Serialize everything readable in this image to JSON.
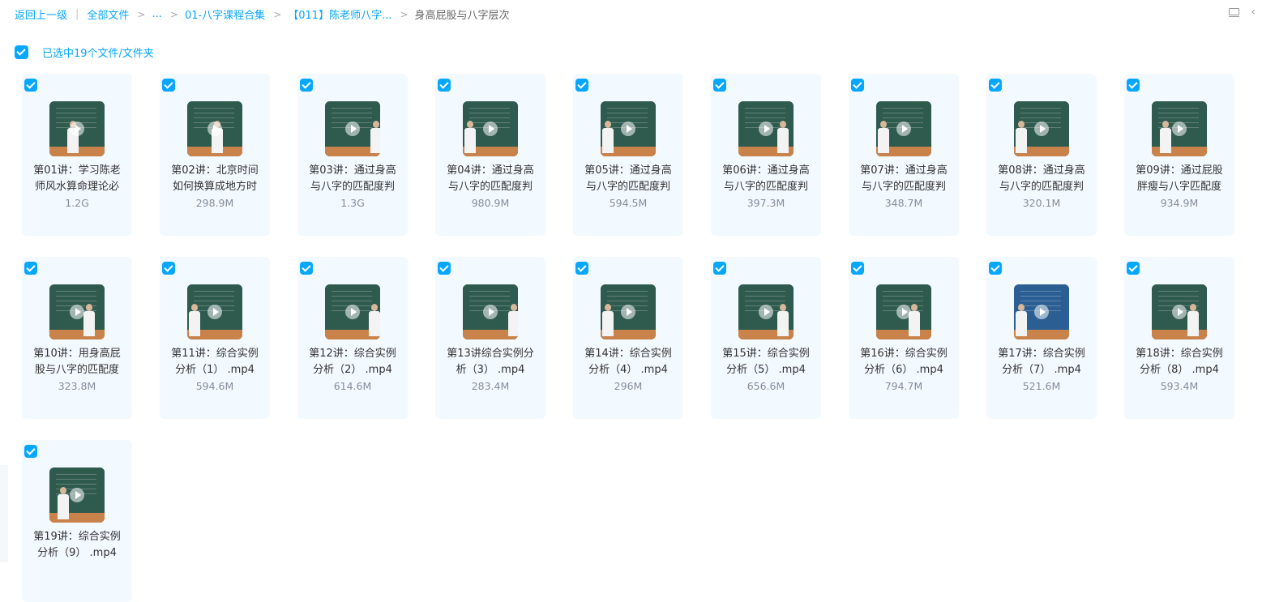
{
  "breadcrumb": {
    "back": "返回上一级",
    "root": "全部文件",
    "ellipsis": "...",
    "folder1": "01-八字课程合集",
    "folder2": "【011】陈老师八字...",
    "current": "身高屁股与八字层次",
    "sep": ">"
  },
  "selection": {
    "text": "已选中19个文件/文件夹"
  },
  "files": [
    {
      "name": "第01讲：学习陈老师风水算命理论必",
      "size": "1.2G"
    },
    {
      "name": "第02讲：北京时间如何换算成地方时",
      "size": "298.9M"
    },
    {
      "name": "第03讲：通过身高与八字的匹配度判",
      "size": "1.3G"
    },
    {
      "name": "第04讲：通过身高与八字的匹配度判",
      "size": "980.9M"
    },
    {
      "name": "第05讲：通过身高与八字的匹配度判",
      "size": "594.5M"
    },
    {
      "name": "第06讲：通过身高与八字的匹配度判",
      "size": "397.3M"
    },
    {
      "name": "第07讲：通过身高与八字的匹配度判",
      "size": "348.7M"
    },
    {
      "name": "第08讲：通过身高与八字的匹配度判",
      "size": "320.1M"
    },
    {
      "name": "第09讲：通过屁股胖瘦与八字匹配度",
      "size": "934.9M"
    },
    {
      "name": "第10讲：用身高屁股与八字的匹配度",
      "size": "323.8M"
    },
    {
      "name": "第11讲：综合实例分析（1） .mp4",
      "size": "594.6M"
    },
    {
      "name": "第12讲：综合实例分析（2） .mp4",
      "size": "614.6M"
    },
    {
      "name": "第13讲综合实例分析（3） .mp4",
      "size": "283.4M"
    },
    {
      "name": "第14讲：综合实例分析（4） .mp4",
      "size": "296M"
    },
    {
      "name": "第15讲：综合实例分析（5） .mp4",
      "size": "656.6M"
    },
    {
      "name": "第16讲：综合实例分析（6） .mp4",
      "size": "794.7M"
    },
    {
      "name": "第17讲：综合实例分析（7） .mp4",
      "size": "521.6M"
    },
    {
      "name": "第18讲：综合实例分析（8） .mp4",
      "size": "593.4M"
    },
    {
      "name": "第19讲：综合实例分析（9） .mp4",
      "size": ""
    }
  ]
}
